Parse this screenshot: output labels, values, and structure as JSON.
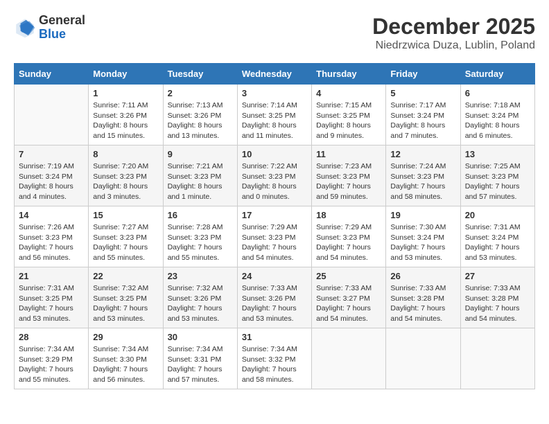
{
  "header": {
    "logo_general": "General",
    "logo_blue": "Blue",
    "month_title": "December 2025",
    "subtitle": "Niedrzwica Duza, Lublin, Poland"
  },
  "days_of_week": [
    "Sunday",
    "Monday",
    "Tuesday",
    "Wednesday",
    "Thursday",
    "Friday",
    "Saturday"
  ],
  "weeks": [
    [
      {
        "day": "",
        "info": ""
      },
      {
        "day": "1",
        "info": "Sunrise: 7:11 AM\nSunset: 3:26 PM\nDaylight: 8 hours\nand 15 minutes."
      },
      {
        "day": "2",
        "info": "Sunrise: 7:13 AM\nSunset: 3:26 PM\nDaylight: 8 hours\nand 13 minutes."
      },
      {
        "day": "3",
        "info": "Sunrise: 7:14 AM\nSunset: 3:25 PM\nDaylight: 8 hours\nand 11 minutes."
      },
      {
        "day": "4",
        "info": "Sunrise: 7:15 AM\nSunset: 3:25 PM\nDaylight: 8 hours\nand 9 minutes."
      },
      {
        "day": "5",
        "info": "Sunrise: 7:17 AM\nSunset: 3:24 PM\nDaylight: 8 hours\nand 7 minutes."
      },
      {
        "day": "6",
        "info": "Sunrise: 7:18 AM\nSunset: 3:24 PM\nDaylight: 8 hours\nand 6 minutes."
      }
    ],
    [
      {
        "day": "7",
        "info": "Sunrise: 7:19 AM\nSunset: 3:24 PM\nDaylight: 8 hours\nand 4 minutes."
      },
      {
        "day": "8",
        "info": "Sunrise: 7:20 AM\nSunset: 3:23 PM\nDaylight: 8 hours\nand 3 minutes."
      },
      {
        "day": "9",
        "info": "Sunrise: 7:21 AM\nSunset: 3:23 PM\nDaylight: 8 hours\nand 1 minute."
      },
      {
        "day": "10",
        "info": "Sunrise: 7:22 AM\nSunset: 3:23 PM\nDaylight: 8 hours\nand 0 minutes."
      },
      {
        "day": "11",
        "info": "Sunrise: 7:23 AM\nSunset: 3:23 PM\nDaylight: 7 hours\nand 59 minutes."
      },
      {
        "day": "12",
        "info": "Sunrise: 7:24 AM\nSunset: 3:23 PM\nDaylight: 7 hours\nand 58 minutes."
      },
      {
        "day": "13",
        "info": "Sunrise: 7:25 AM\nSunset: 3:23 PM\nDaylight: 7 hours\nand 57 minutes."
      }
    ],
    [
      {
        "day": "14",
        "info": "Sunrise: 7:26 AM\nSunset: 3:23 PM\nDaylight: 7 hours\nand 56 minutes."
      },
      {
        "day": "15",
        "info": "Sunrise: 7:27 AM\nSunset: 3:23 PM\nDaylight: 7 hours\nand 55 minutes."
      },
      {
        "day": "16",
        "info": "Sunrise: 7:28 AM\nSunset: 3:23 PM\nDaylight: 7 hours\nand 55 minutes."
      },
      {
        "day": "17",
        "info": "Sunrise: 7:29 AM\nSunset: 3:23 PM\nDaylight: 7 hours\nand 54 minutes."
      },
      {
        "day": "18",
        "info": "Sunrise: 7:29 AM\nSunset: 3:23 PM\nDaylight: 7 hours\nand 54 minutes."
      },
      {
        "day": "19",
        "info": "Sunrise: 7:30 AM\nSunset: 3:24 PM\nDaylight: 7 hours\nand 53 minutes."
      },
      {
        "day": "20",
        "info": "Sunrise: 7:31 AM\nSunset: 3:24 PM\nDaylight: 7 hours\nand 53 minutes."
      }
    ],
    [
      {
        "day": "21",
        "info": "Sunrise: 7:31 AM\nSunset: 3:25 PM\nDaylight: 7 hours\nand 53 minutes."
      },
      {
        "day": "22",
        "info": "Sunrise: 7:32 AM\nSunset: 3:25 PM\nDaylight: 7 hours\nand 53 minutes."
      },
      {
        "day": "23",
        "info": "Sunrise: 7:32 AM\nSunset: 3:26 PM\nDaylight: 7 hours\nand 53 minutes."
      },
      {
        "day": "24",
        "info": "Sunrise: 7:33 AM\nSunset: 3:26 PM\nDaylight: 7 hours\nand 53 minutes."
      },
      {
        "day": "25",
        "info": "Sunrise: 7:33 AM\nSunset: 3:27 PM\nDaylight: 7 hours\nand 54 minutes."
      },
      {
        "day": "26",
        "info": "Sunrise: 7:33 AM\nSunset: 3:28 PM\nDaylight: 7 hours\nand 54 minutes."
      },
      {
        "day": "27",
        "info": "Sunrise: 7:33 AM\nSunset: 3:28 PM\nDaylight: 7 hours\nand 54 minutes."
      }
    ],
    [
      {
        "day": "28",
        "info": "Sunrise: 7:34 AM\nSunset: 3:29 PM\nDaylight: 7 hours\nand 55 minutes."
      },
      {
        "day": "29",
        "info": "Sunrise: 7:34 AM\nSunset: 3:30 PM\nDaylight: 7 hours\nand 56 minutes."
      },
      {
        "day": "30",
        "info": "Sunrise: 7:34 AM\nSunset: 3:31 PM\nDaylight: 7 hours\nand 57 minutes."
      },
      {
        "day": "31",
        "info": "Sunrise: 7:34 AM\nSunset: 3:32 PM\nDaylight: 7 hours\nand 58 minutes."
      },
      {
        "day": "",
        "info": ""
      },
      {
        "day": "",
        "info": ""
      },
      {
        "day": "",
        "info": ""
      }
    ]
  ]
}
